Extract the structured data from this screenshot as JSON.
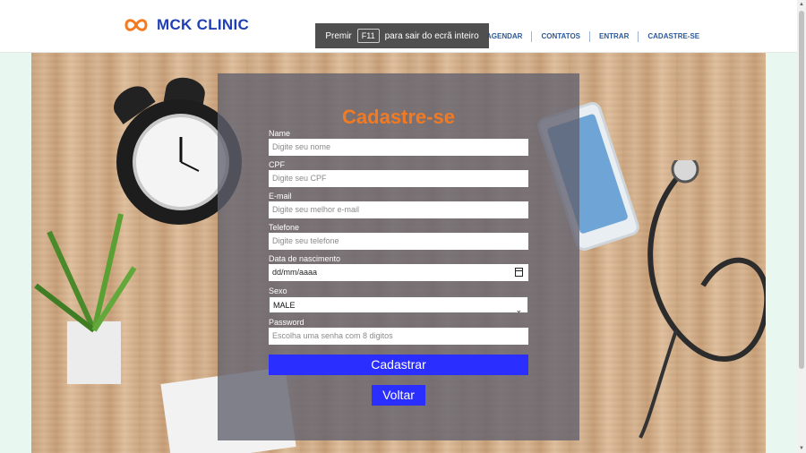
{
  "brand": {
    "name": "MCK CLINIC",
    "logo_icon": "infinity-logo-icon",
    "color": "#1f3fb6",
    "logo_color": "#f47a21"
  },
  "fullscreen_hint": {
    "prefix": "Premir",
    "key": "F11",
    "suffix": "para sair do ecrã inteiro"
  },
  "nav": {
    "items": [
      "AGENDAR",
      "CONTATOS",
      "ENTRAR",
      "CADASTRE-SE"
    ]
  },
  "form": {
    "title": "Cadastre-se",
    "fields": [
      {
        "label": "Name",
        "placeholder": "Digite seu nome"
      },
      {
        "label": "CPF",
        "placeholder": "Digite seu CPF"
      },
      {
        "label": "E-mail",
        "placeholder": "Digite seu melhor e-mail"
      },
      {
        "label": "Telefone",
        "placeholder": "Digite seu telefone"
      },
      {
        "label": "Data de nascimento",
        "placeholder": "dd/mm/aaaa"
      },
      {
        "label": "Sexo",
        "value": "MALE"
      },
      {
        "label": "Password",
        "placeholder": "Escolha uma senha com 8 digitos"
      }
    ],
    "submit_label": "Cadastrar",
    "back_label": "Voltar",
    "title_color": "#f47a21",
    "button_color": "#2a2eff"
  }
}
